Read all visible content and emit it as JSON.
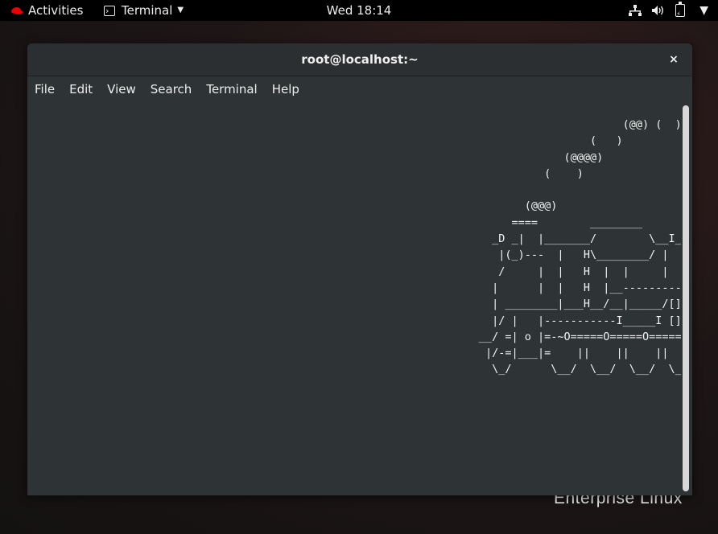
{
  "topbar": {
    "activities_label": "Activities",
    "app_menu_label": "Terminal",
    "clock": "Wed 18:14",
    "icons": [
      "redhat-logo-icon",
      "terminal-icon",
      "network-icon",
      "volume-icon",
      "battery-charging-icon"
    ]
  },
  "desktop": {
    "brand_text": "Enterprise Linux"
  },
  "window": {
    "title": "root@localhost:~",
    "close_label": "×",
    "menu": [
      "File",
      "Edit",
      "View",
      "Search",
      "Terminal",
      "Help"
    ]
  },
  "terminal": {
    "lines": [
      "                                                                                           (@@) (  ) (@)  ( )",
      "                                                                                      (   )",
      "                                                                                  (@@@@)",
      "                                                                               (    )",
      "",
      "                                                                            (@@@)",
      "                                                                          ====        ________",
      "                                                                       _D _|  |_______/        \\__I_I_____===",
      "                                                                        |(_)---  |   H\\________/ |   |",
      "                                                                        /     |  |   H  |  |     |   |",
      "                                                                       |      |  |   H  |__-----------------",
      "                                                                       | ________|___H__/__|_____/[][]~\\_____",
      "                                                                       |/ |   |-----------I_____I [][] []  D",
      "                                                                     __/ =| o |=-~O=====O=====O=====O\\ ____Y_",
      "                                                                      |/-=|___|=    ||    ||    ||    |_____/",
      "                                                                       \\_/      \\__/  \\__/  \\__/  \\__/      \\"
    ]
  },
  "colors": {
    "terminal_bg": "#2e3436",
    "terminal_fg": "#f2f2f2",
    "topbar_bg": "#000000",
    "redhat_red": "#ee0000"
  }
}
